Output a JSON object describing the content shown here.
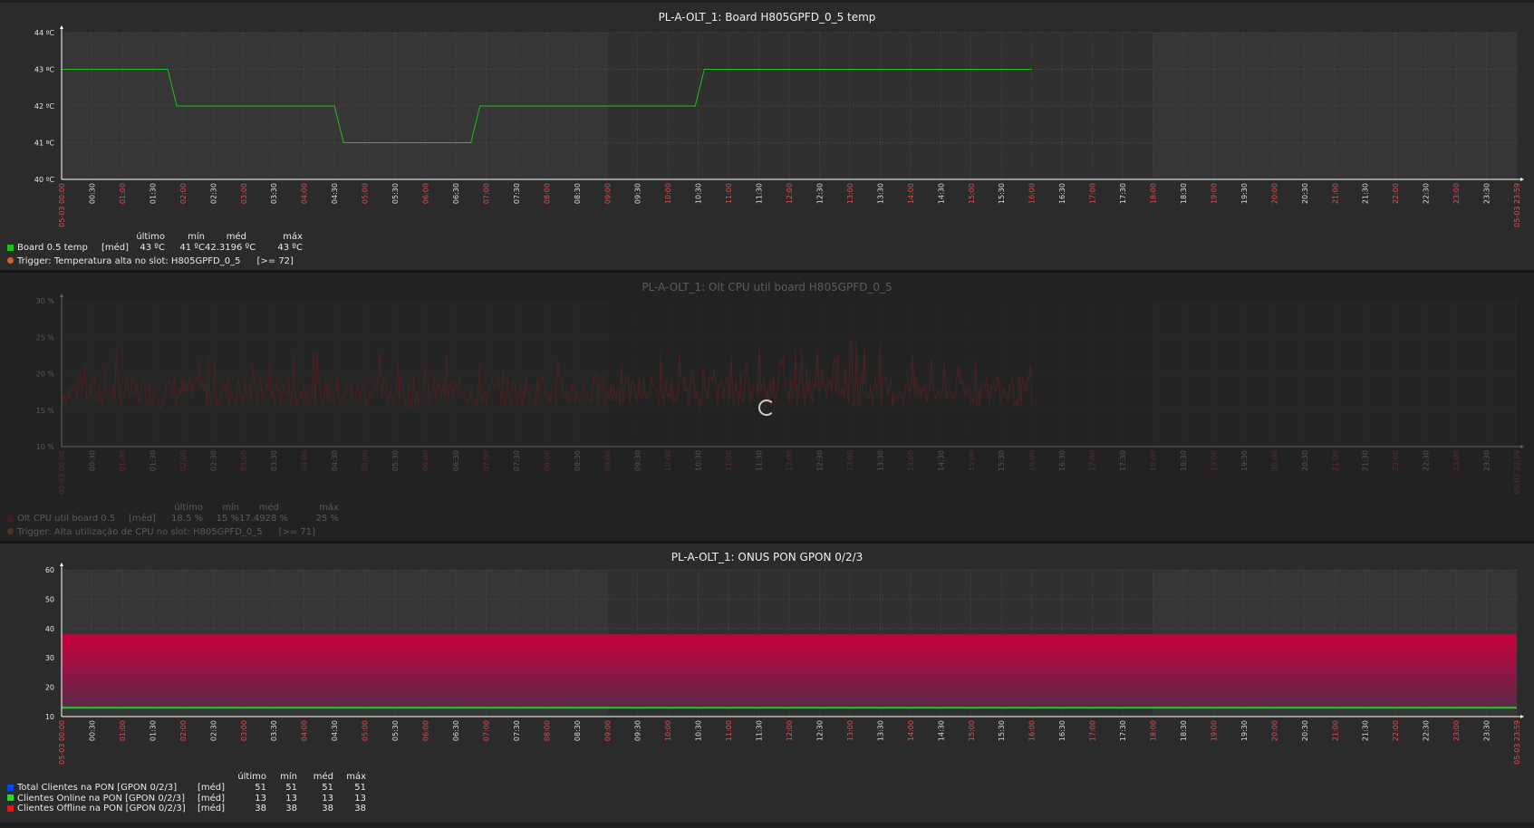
{
  "x_ticks": [
    "05-03 00:00",
    "00:30",
    "01:00",
    "01:30",
    "02:00",
    "02:30",
    "03:00",
    "03:30",
    "04:00",
    "04:30",
    "05:00",
    "05:30",
    "06:00",
    "06:30",
    "07:00",
    "07:30",
    "08:00",
    "08:30",
    "09:00",
    "09:30",
    "10:00",
    "10:30",
    "11:00",
    "11:30",
    "12:00",
    "12:30",
    "13:00",
    "13:30",
    "14:00",
    "14:30",
    "15:00",
    "15:30",
    "16:00",
    "16:30",
    "17:00",
    "17:30",
    "18:00",
    "18:30",
    "19:00",
    "19:30",
    "20:00",
    "20:30",
    "21:00",
    "21:30",
    "22:00",
    "22:30",
    "23:00",
    "23:30",
    "05-03 23:59"
  ],
  "colors": {
    "bg": "#2b2b2b",
    "plot_bg": "#333333",
    "grid": "#444444",
    "red_tick": "#e05050",
    "white_tick": "#dcdcdc",
    "green": "#1fbf1f",
    "cpu": "#7a1a1a",
    "blue": "#0047f0",
    "magenta": "#c8003c",
    "online": "#22cc22"
  },
  "chart_data": [
    {
      "type": "line",
      "title": "PL-A-OLT_1: Board H805GPFD_0_5 temp",
      "yticks": [
        "40 ºC",
        "41 ºC",
        "42 ºC",
        "43 ºC",
        "44 ºC"
      ],
      "ylim": [
        40,
        44
      ],
      "x_unit": "hours",
      "series": [
        {
          "name": "Board 0.5 temp",
          "color": "#1fbf1f",
          "points": [
            [
              0,
              43
            ],
            [
              1.75,
              43
            ],
            [
              1.9,
              42
            ],
            [
              4.5,
              42
            ],
            [
              4.65,
              41
            ],
            [
              6.75,
              41
            ],
            [
              6.9,
              42
            ],
            [
              10.45,
              42
            ],
            [
              10.6,
              43
            ],
            [
              16,
              43
            ]
          ]
        }
      ],
      "legend": {
        "headers": [
          "último",
          "mín",
          "méd",
          "máx"
        ],
        "rows": [
          {
            "label": "Board 0.5 temp",
            "func": "[méd]",
            "values": [
              "43 ºC",
              "41 ºC",
              "42.3196 ºC",
              "43 ºC"
            ],
            "color": "#1fbf1f"
          }
        ],
        "trigger": "Trigger: Temperatura alta no slot: H805GPFD_0_5",
        "trigger_value": "[>= 72]"
      }
    },
    {
      "type": "line",
      "title": "PL-A-OLT_1: Olt CPU util board H805GPFD_0_5",
      "yticks": [
        "10 %",
        "15 %",
        "20 %",
        "25 %",
        "30 %"
      ],
      "ylim": [
        10,
        30
      ],
      "x_unit": "hours",
      "series": [
        {
          "name": "Olt CPU util board 0.5",
          "color": "#7a1a1a",
          "range": [
            0,
            16
          ],
          "min": 15,
          "max": 25,
          "avg": 17.4928
        }
      ],
      "legend": {
        "headers": [
          "último",
          "mín",
          "méd",
          "máx"
        ],
        "rows": [
          {
            "label": "Olt CPU util board 0.5",
            "func": "[méd]",
            "values": [
              "18.5 %",
              "15 %",
              "17.4928 %",
              "25 %"
            ],
            "color": "#8a1a1a"
          }
        ],
        "trigger": "Trigger: Alta utilização de CPU no slot: H805GPFD_0_5",
        "trigger_value": "[>= 71]"
      }
    },
    {
      "type": "area",
      "title": "PL-A-OLT_1: ONUS PON GPON 0/2/3",
      "yticks": [
        "10",
        "20",
        "30",
        "40",
        "50",
        "60"
      ],
      "ylim": [
        10,
        60
      ],
      "x_unit": "hours",
      "series": [
        {
          "name": "Total Clientes na PON [GPON 0/2/3]",
          "color": "#0047f0",
          "value": 51
        },
        {
          "name": "Clientes Online na PON [GPON 0/2/3]",
          "color": "#22cc22",
          "value": 13
        },
        {
          "name": "Clientes Offline na PON [GPON 0/2/3]",
          "color": "#c8003c",
          "value": 38
        }
      ],
      "legend": {
        "headers": [
          "último",
          "mín",
          "méd",
          "máx"
        ],
        "rows": [
          {
            "label": "Total Clientes na PON [GPON 0/2/3]",
            "func": "[méd]",
            "values": [
              "51",
              "51",
              "51",
              "51"
            ],
            "color": "#0047f0"
          },
          {
            "label": "Clientes Online na PON [GPON 0/2/3]",
            "func": "[méd]",
            "values": [
              "13",
              "13",
              "13",
              "13"
            ],
            "color": "#22dd22"
          },
          {
            "label": "Clientes Offline na PON [GPON 0/2/3]",
            "func": "[méd]",
            "values": [
              "38",
              "38",
              "38",
              "38"
            ],
            "color": "#ee1111"
          }
        ]
      }
    }
  ]
}
